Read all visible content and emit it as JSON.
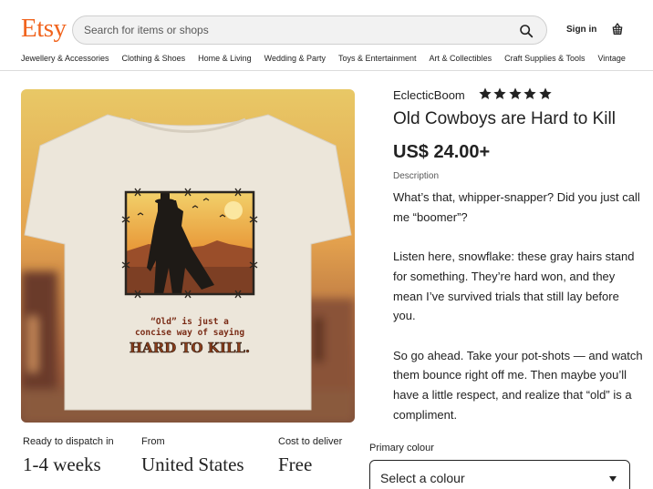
{
  "header": {
    "logo": "Etsy",
    "search_placeholder": "Search for items or shops",
    "signin": "Sign in",
    "nav": [
      "Jewellery & Accessories",
      "Clothing & Shoes",
      "Home & Living",
      "Wedding & Party",
      "Toys & Entertainment",
      "Art & Collectibles",
      "Craft Supplies & Tools",
      "Vintage"
    ]
  },
  "product": {
    "shop_name": "EclecticBoom",
    "rating_stars": 5,
    "title": "Old Cowboys are Hard to Kill",
    "price": "US$ 24.00+",
    "description_label": "Description",
    "description": [
      "What’s that, whipper-snapper? Did you just call me “boomer”?",
      "Listen here, snowflake: these gray hairs stand for something. They’re hard won, and they mean I’ve survived trials that still lay before you.",
      "So go ahead. Take your pot-shots — and watch them bounce right off me. Then maybe you’ll have a little respect, and realize that “old” is a compliment."
    ],
    "image": {
      "caption_line1": "“Old” is just a",
      "caption_line2": "concise way of saying",
      "caption_line3": "HARD TO KILL."
    }
  },
  "shipping": {
    "dispatch_label": "Ready to dispatch in",
    "dispatch_value": "1-4 weeks",
    "from_label": "From",
    "from_value": "United States",
    "cost_label": "Cost to deliver",
    "cost_value": "Free"
  },
  "options": {
    "primary_colour_label": "Primary colour",
    "primary_colour_value": "Select a colour"
  },
  "colors": {
    "brand": "#f1641e",
    "text": "#222222",
    "star": "#222222"
  }
}
